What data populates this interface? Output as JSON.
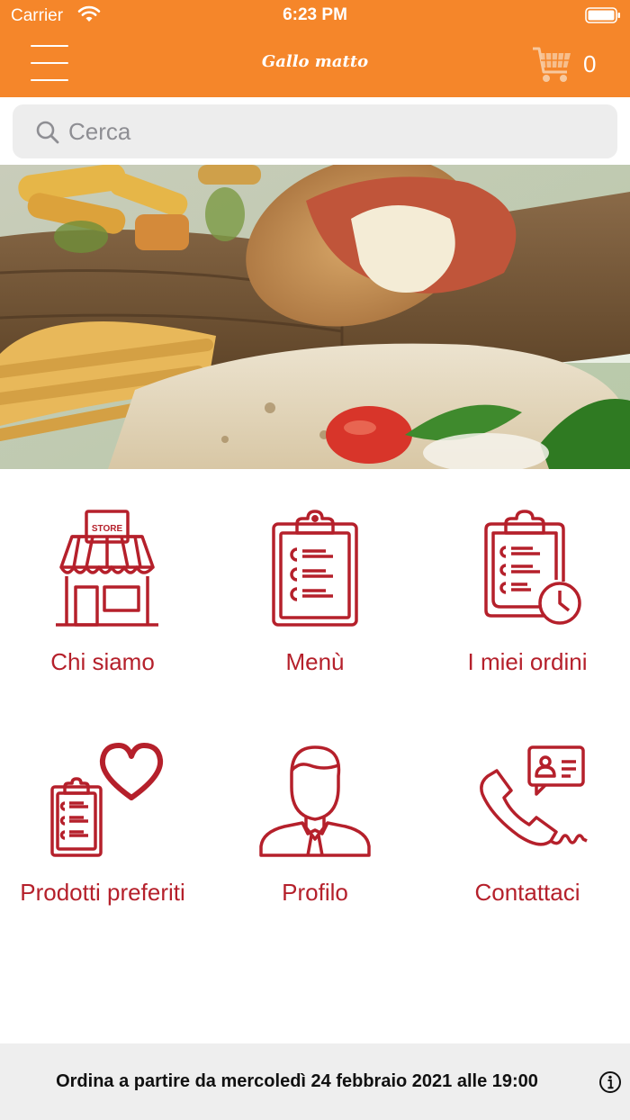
{
  "status_bar": {
    "carrier": "Carrier",
    "time": "6:23 PM"
  },
  "navbar": {
    "title": "Gallo matto",
    "cart_count": "0"
  },
  "search": {
    "placeholder": "Cerca"
  },
  "menu_tiles": [
    {
      "label": "Chi siamo",
      "icon": "store-icon",
      "store_sign": "STORE"
    },
    {
      "label": "Menù",
      "icon": "clipboard-list-icon"
    },
    {
      "label": "I miei ordini",
      "icon": "clipboard-clock-icon"
    },
    {
      "label": "Prodotti preferiti",
      "icon": "clipboard-heart-icon"
    },
    {
      "label": "Profilo",
      "icon": "person-icon"
    },
    {
      "label": "Contattaci",
      "icon": "phone-contact-icon"
    }
  ],
  "footer": {
    "message": "Ordina a partire da mercoledì 24 febbraio 2021 alle 19:00"
  },
  "colors": {
    "brand": "#f5862a",
    "accent": "#b5202b",
    "footer_bg": "#eeeeee"
  }
}
